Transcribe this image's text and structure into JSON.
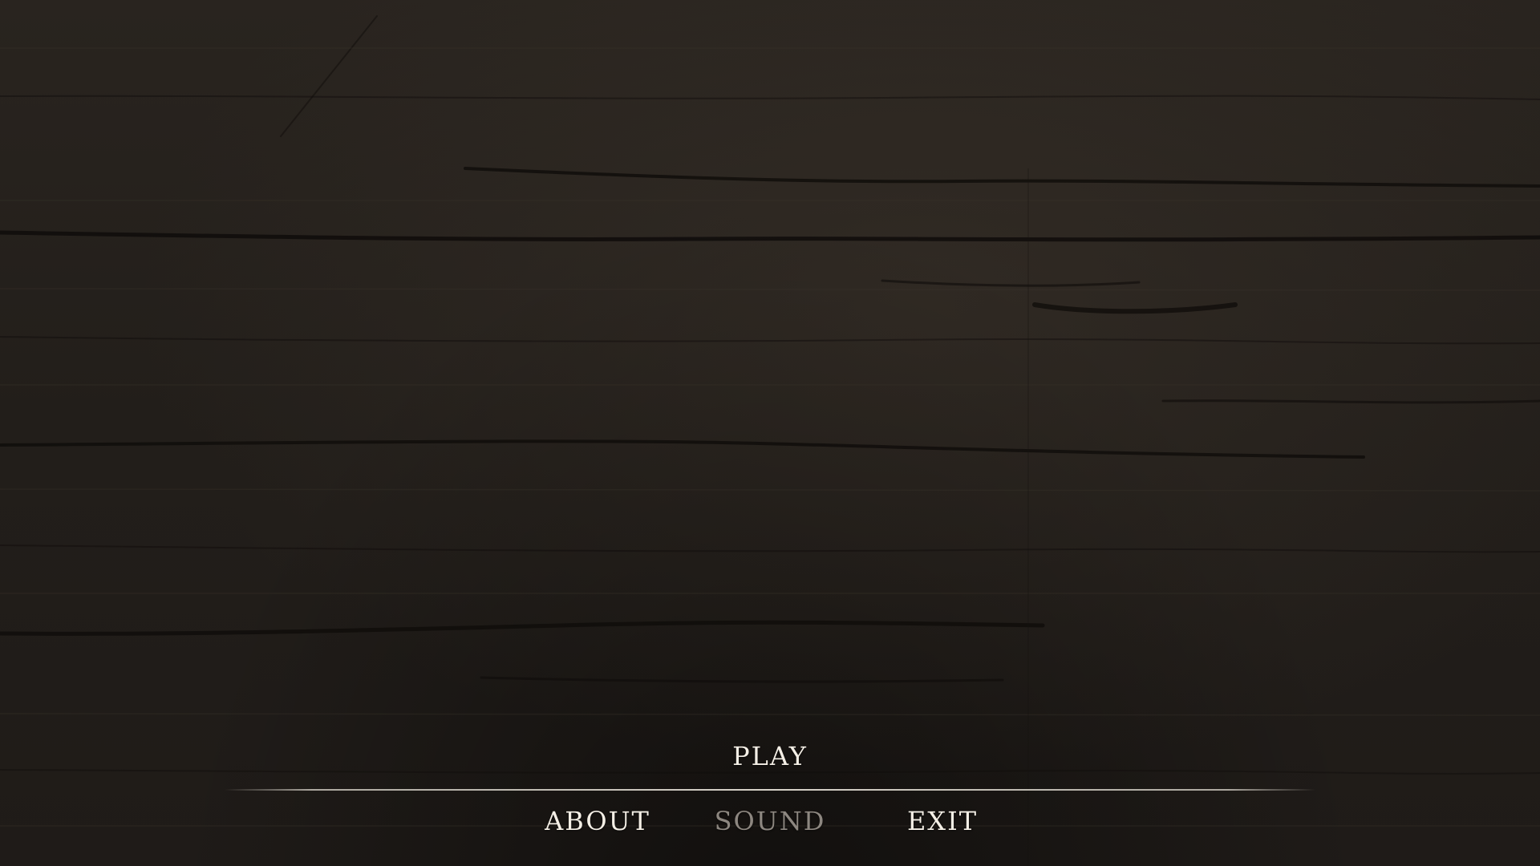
{
  "menu": {
    "play": "PLAY",
    "about": "ABOUT",
    "sound": "SOUND",
    "exit": "EXIT"
  },
  "colors": {
    "background": "#231f1b",
    "text_active": "#f4efe6",
    "text_dimmed": "#8d8780"
  },
  "background": {
    "texture": "dark-wood-planks"
  }
}
